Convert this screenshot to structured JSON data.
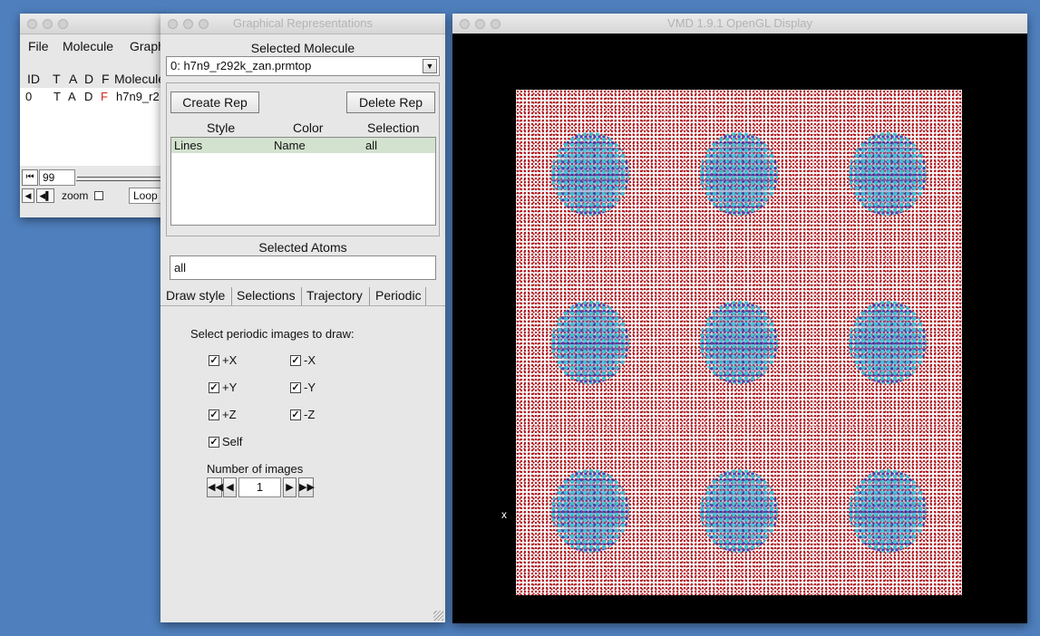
{
  "main_window": {
    "menu": [
      "File",
      "Molecule",
      "Graph"
    ],
    "columns": [
      "ID",
      "T",
      "A",
      "D",
      "F",
      "Molecule"
    ],
    "molecule_row": {
      "id": "0",
      "t": "T",
      "a": "A",
      "d": "D",
      "f": "F",
      "name": "h7n9_r2"
    },
    "frame_value": "99",
    "zoom_label": "zoom",
    "loop_label": "Loop"
  },
  "reps_window": {
    "title": "Graphical Representations",
    "selected_molecule_label": "Selected Molecule",
    "selected_molecule": "0: h7n9_r292k_zan.prmtop",
    "create_rep": "Create Rep",
    "delete_rep": "Delete Rep",
    "table_headers": [
      "Style",
      "Color",
      "Selection"
    ],
    "reps": [
      {
        "style": "Lines",
        "color": "Name",
        "selection": "all"
      }
    ],
    "selected_atoms_label": "Selected Atoms",
    "selected_atoms": "all",
    "tabs": [
      "Draw style",
      "Selections",
      "Trajectory",
      "Periodic"
    ],
    "active_tab": "Periodic",
    "periodic": {
      "prompt": "Select periodic images to draw:",
      "options": [
        {
          "label": "+X",
          "checked": true
        },
        {
          "label": "-X",
          "checked": true
        },
        {
          "label": "+Y",
          "checked": true
        },
        {
          "label": "-Y",
          "checked": true
        },
        {
          "label": "+Z",
          "checked": true
        },
        {
          "label": "-Z",
          "checked": true
        },
        {
          "label": "Self",
          "checked": true
        }
      ],
      "num_images_label": "Number of images",
      "num_images": "1"
    }
  },
  "display_window": {
    "title": "VMD 1.9.1 OpenGL Display",
    "axis_marker": "x",
    "colors": {
      "background": "#000000",
      "water_oxygen": "#b3121c",
      "hydrogen": "#f2f2f2",
      "protein_cyan": "#2bc3d6",
      "protein_blue": "#2a2fb0"
    }
  }
}
